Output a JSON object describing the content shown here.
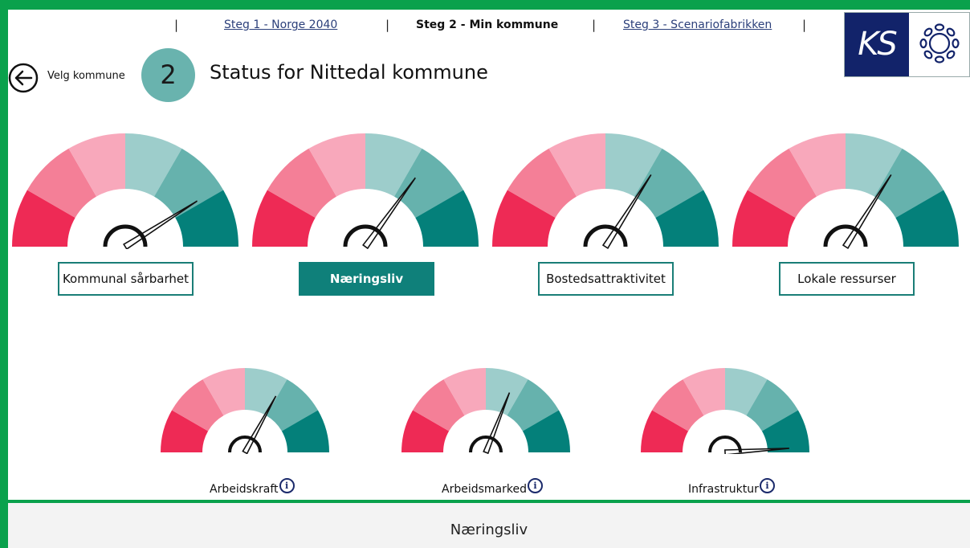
{
  "nav": {
    "separator": "|",
    "step1": "Steg 1 - Norge 2040",
    "step2": "Steg 2 - Min kommune",
    "step3": "Steg 3 - Scenariofabrikken"
  },
  "logo": {
    "text": "KS"
  },
  "back": {
    "label": "Velg kommune"
  },
  "header": {
    "step_number": "2",
    "title": "Status for Nittedal kommune"
  },
  "gauges": [
    {
      "label": "Kommunal sårbarhet",
      "value": 0.82,
      "active": false
    },
    {
      "label": "Næringsliv",
      "value": 0.7,
      "active": true
    },
    {
      "label": "Bostedsattraktivitet",
      "value": 0.68,
      "active": false
    },
    {
      "label": "Lokale ressurser",
      "value": 0.68,
      "active": false
    }
  ],
  "sub_gauges": [
    {
      "label": "Arbeidskraft",
      "value": 0.66
    },
    {
      "label": "Arbeidsmarked",
      "value": 0.62
    },
    {
      "label": "Infrastruktur",
      "value": 0.98
    }
  ],
  "info_icon": "i",
  "colors": {
    "seg1": "#ee2a55",
    "seg2": "#f47f97",
    "seg3": "#f8a8bb",
    "seg4": "#9dcdcb",
    "seg5": "#66b2ad",
    "seg6": "#04807a",
    "needle": "#111111",
    "accent": "#0aa14c"
  },
  "footer": {
    "title": "Næringsliv"
  }
}
